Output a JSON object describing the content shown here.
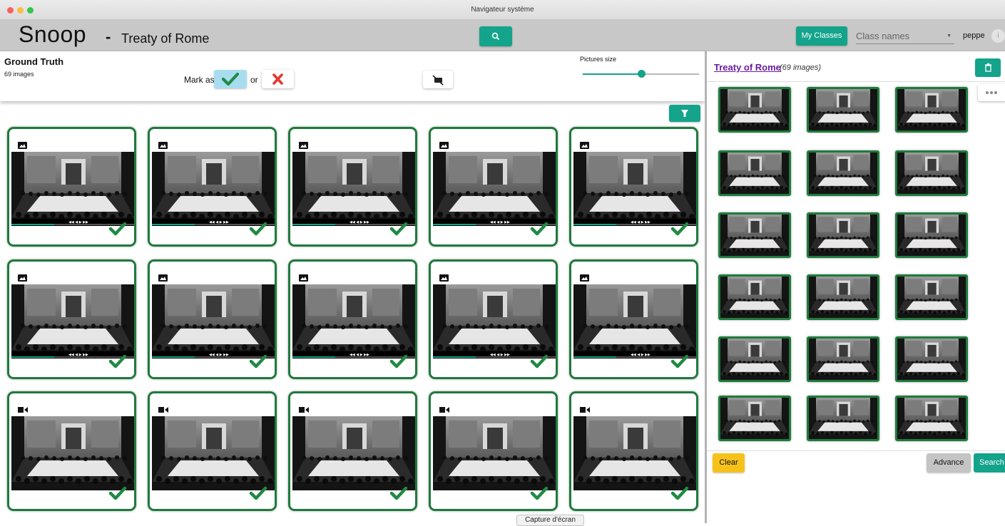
{
  "window": {
    "title": "Navigateur système"
  },
  "header": {
    "brand": "Snoop",
    "separator": "-",
    "project": "Treaty of Rome",
    "my_classes_label": "My Classes",
    "class_names_placeholder": "Class names",
    "username": "peppe",
    "search_icon": "search-icon"
  },
  "toolbar": {
    "title": "Ground Truth",
    "count": "69 images",
    "mark_as": "Mark as",
    "or": "or",
    "pictures_size_label": "Pictures size",
    "pictures_size_value": 0.5
  },
  "grid": {
    "cards": [
      {
        "media": "image",
        "label": "positive"
      },
      {
        "media": "image",
        "label": "positive"
      },
      {
        "media": "image",
        "label": "positive"
      },
      {
        "media": "image",
        "label": "positive"
      },
      {
        "media": "image",
        "label": "positive"
      },
      {
        "media": "image",
        "label": "positive"
      },
      {
        "media": "image",
        "label": "positive"
      },
      {
        "media": "image",
        "label": "positive"
      },
      {
        "media": "image",
        "label": "positive"
      },
      {
        "media": "image",
        "label": "positive"
      },
      {
        "media": "video",
        "label": "positive"
      },
      {
        "media": "video",
        "label": "positive"
      },
      {
        "media": "video",
        "label": "positive"
      },
      {
        "media": "video",
        "label": "positive"
      },
      {
        "media": "video",
        "label": "positive"
      }
    ]
  },
  "class_panel": {
    "class_name": "Treaty of Rome",
    "image_count": "(69 images)",
    "thumbnail_count": 18,
    "clear_label": "Clear",
    "advance_label": "Advance",
    "search_label": "Search"
  },
  "tooltip": "Capture d'écran",
  "colors": {
    "accent": "#14a38b",
    "positive_border": "#1f7a3d",
    "check": "#1f8a43",
    "reject": "#e53935",
    "class_link": "#6a1b9a",
    "clear": "#f6c21a"
  }
}
